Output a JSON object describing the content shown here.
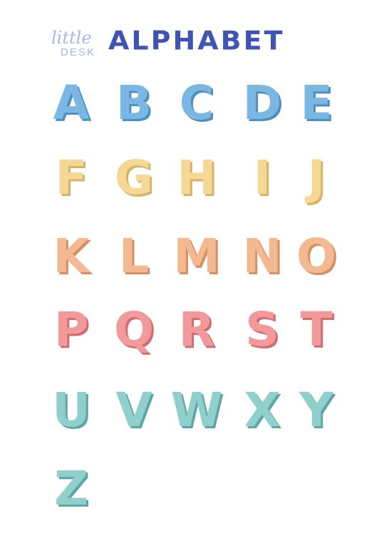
{
  "header": {
    "logo_top": "little",
    "logo_bottom": "DESK",
    "title": "ALPHABET"
  },
  "colors": {
    "logo": "#a9b6e6",
    "title": "#4153b3",
    "blue": "#7ab7e2",
    "blue_shadow": "#4f8fc0",
    "yellow": "#f6d896",
    "yellow_shadow": "#d7b36a",
    "peach": "#f3b990",
    "peach_shadow": "#d58f62",
    "pink": "#f1999b",
    "pink_shadow": "#d16c72",
    "teal": "#8fcfcc",
    "teal_shadow": "#5ea6a3"
  },
  "rows": [
    {
      "color": "blue",
      "letters": [
        "A",
        "B",
        "C",
        "D",
        "E"
      ]
    },
    {
      "color": "yellow",
      "letters": [
        "F",
        "G",
        "H",
        "I",
        "J"
      ]
    },
    {
      "color": "peach",
      "letters": [
        "K",
        "L",
        "M",
        "N",
        "O"
      ]
    },
    {
      "color": "pink",
      "letters": [
        "P",
        "Q",
        "R",
        "S",
        "T"
      ]
    },
    {
      "color": "teal",
      "letters": [
        "U",
        "V",
        "W",
        "X",
        "Y"
      ]
    },
    {
      "color": "teal",
      "letters": [
        "Z"
      ]
    }
  ]
}
